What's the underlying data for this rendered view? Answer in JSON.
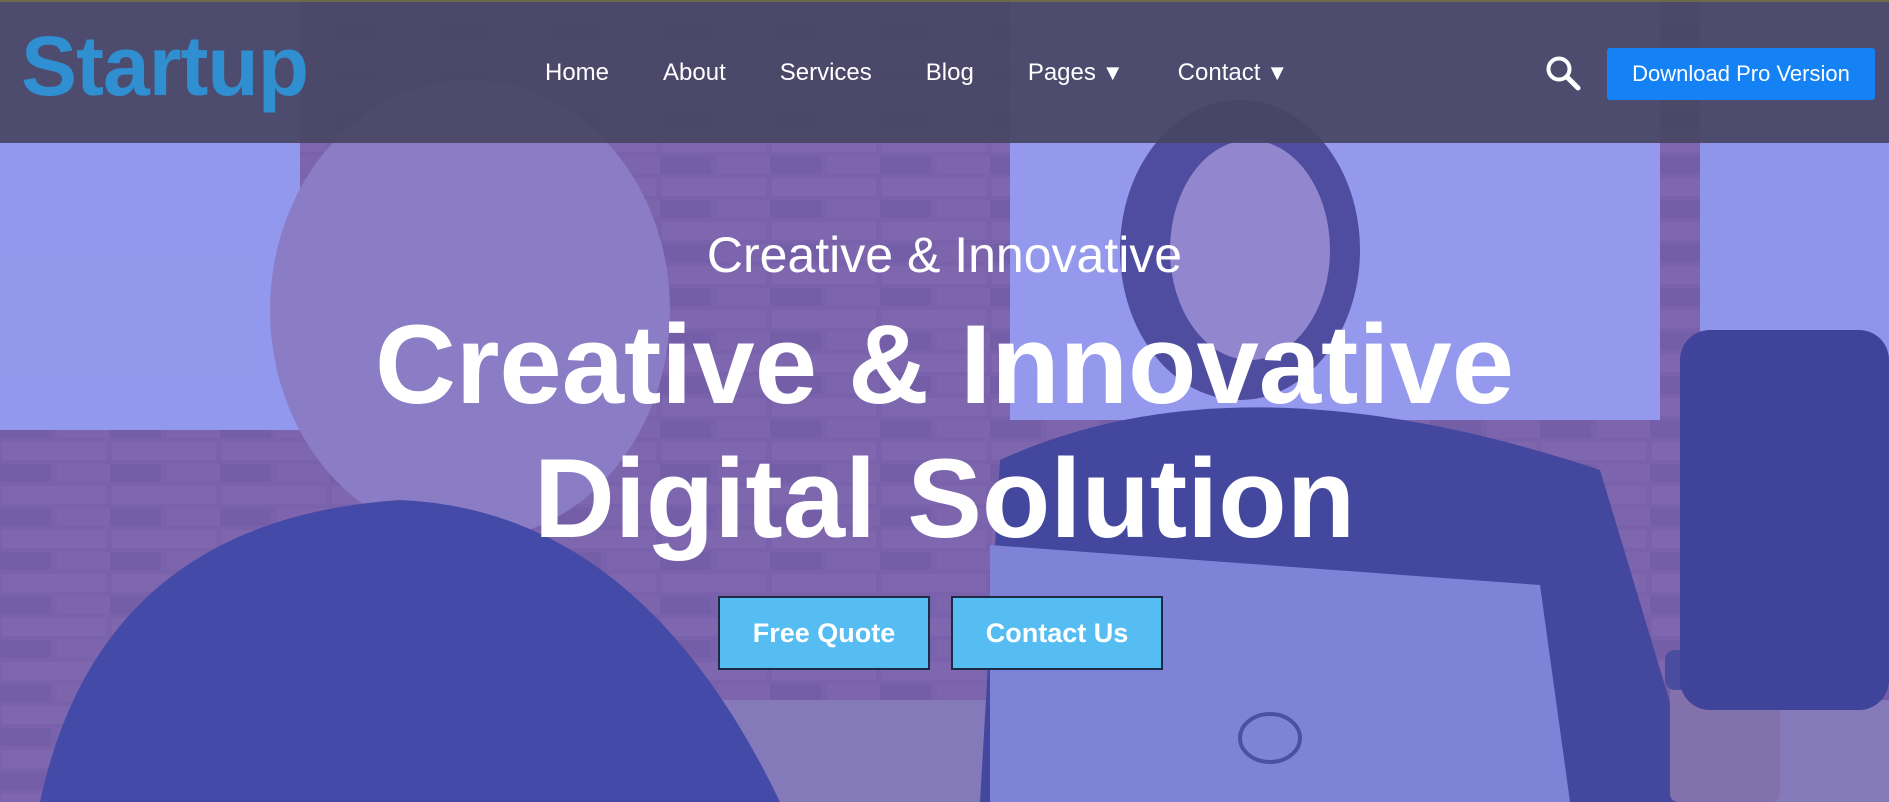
{
  "navbar": {
    "logo": "Startup",
    "menu": [
      {
        "label": "Home",
        "has_dropdown": false
      },
      {
        "label": "About",
        "has_dropdown": false
      },
      {
        "label": "Services",
        "has_dropdown": false
      },
      {
        "label": "Blog",
        "has_dropdown": false
      },
      {
        "label": "Pages",
        "has_dropdown": true
      },
      {
        "label": "Contact",
        "has_dropdown": true
      }
    ],
    "dropdown_caret": "▼",
    "search_icon": "search-icon",
    "download_label": "Download Pro Version"
  },
  "hero": {
    "subtitle": "Creative & Innovative",
    "title_line1": "Creative & Innovative",
    "title_line2": "Digital Solution",
    "buttons": {
      "quote": "Free Quote",
      "contact": "Contact Us"
    }
  },
  "colors": {
    "logo": "#2f8fd0",
    "download_button": "#1482f5",
    "cta_button": "#56bdf3",
    "overlay": "#5c62e6"
  }
}
